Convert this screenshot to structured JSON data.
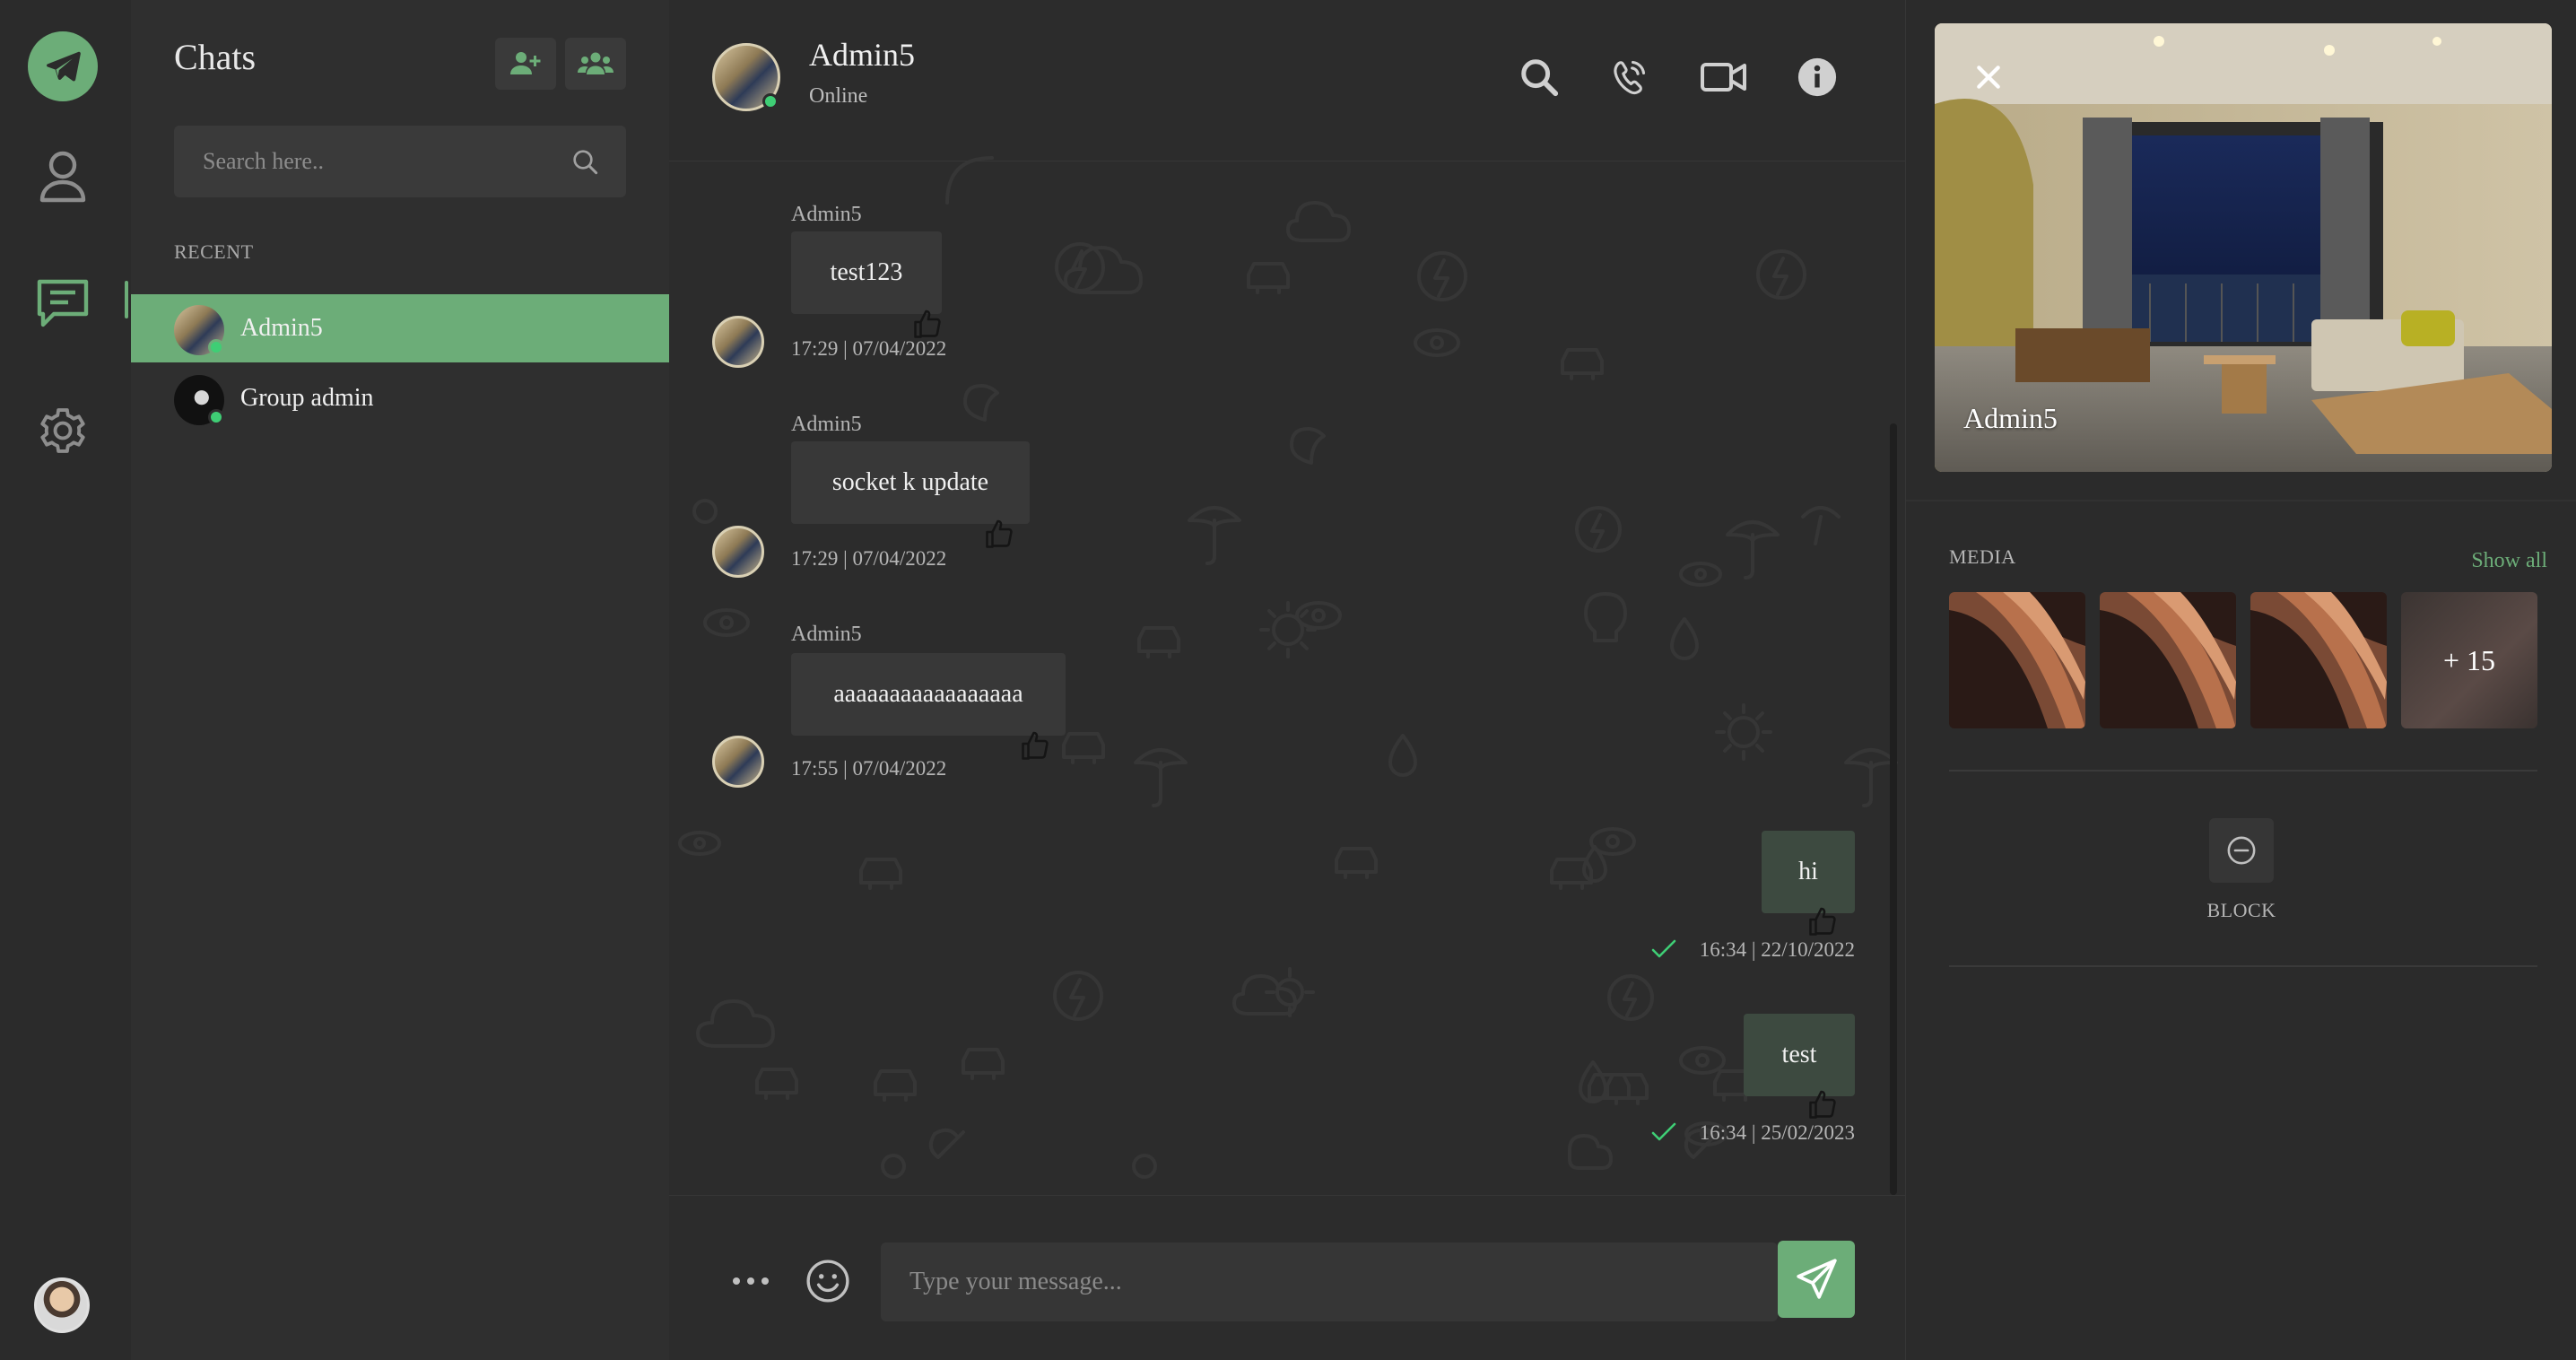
{
  "theme": {
    "accent": "#6cad78",
    "online": "#3fce75",
    "background": "#262626"
  },
  "rail": {
    "icons": [
      "paper-plane-icon",
      "user-icon",
      "chat-bubble-icon",
      "gear-icon"
    ],
    "active": "chat-bubble-icon"
  },
  "chatlist": {
    "title": "Chats",
    "search_placeholder": "Search here..",
    "section_label": "RECENT",
    "items": [
      {
        "name": "Admin5",
        "online": true,
        "active": true
      },
      {
        "name": "Group admin",
        "online": true,
        "active": false
      }
    ]
  },
  "chat": {
    "header": {
      "name": "Admin5",
      "status": "Online"
    },
    "messages": [
      {
        "sender": "Admin5",
        "text": "test123",
        "time": "17:29 | 07/04/2022",
        "direction": "in"
      },
      {
        "sender": "Admin5",
        "text": "socket k update",
        "time": "17:29 | 07/04/2022",
        "direction": "in"
      },
      {
        "sender": "Admin5",
        "text": "aaaaaaaaaaaaaaaaa",
        "time": "17:55 | 07/04/2022",
        "direction": "in"
      },
      {
        "text": "hi",
        "time": "16:34 | 22/10/2022",
        "direction": "out"
      },
      {
        "text": "test",
        "time": "16:34 | 25/02/2023",
        "direction": "out"
      }
    ],
    "composer": {
      "placeholder": "Type your message..."
    }
  },
  "profile": {
    "name": "Admin5",
    "media_label": "MEDIA",
    "show_all": "Show all",
    "more_count": "+ 15",
    "block_label": "BLOCK"
  }
}
